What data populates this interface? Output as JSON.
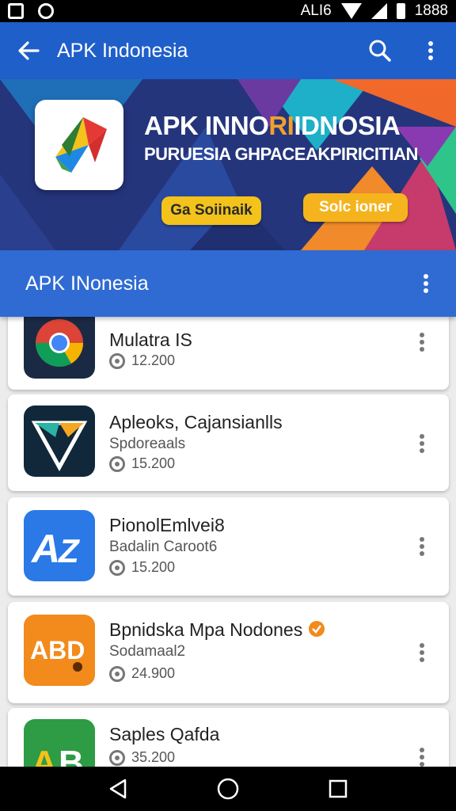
{
  "status_bar": {
    "carrier": "ΑLI6",
    "time": "1888",
    "icons": [
      "image-icon",
      "app-icon",
      "wifi-icon",
      "signal-icon",
      "battery-icon"
    ]
  },
  "app_bar": {
    "title": "APK Indonesia",
    "back_icon": "arrow-left-icon",
    "search_icon": "search-icon",
    "menu_icon": "more-vert-icon"
  },
  "banner": {
    "headline_part1": "APK INNO",
    "headline_part2": "RI",
    "headline_part3": "IDNOSIA",
    "subline": "PURUESIA GHPACEAKPIRICITIAN",
    "button1_label": "Ga Soiinaik",
    "button2_label": "Solc ioner",
    "colors": {
      "accent": "#f3c21b",
      "bg": "#24357a"
    }
  },
  "section": {
    "title": "APK INonesia",
    "menu_icon": "more-vert-icon"
  },
  "apps": [
    {
      "name": "Mulatra IS",
      "sub": "",
      "downloads": "12.200",
      "icon": "chrome-icon"
    },
    {
      "name": "Apleoks, Cajansianlls",
      "sub": "Spdoreaals",
      "downloads": "15.200",
      "icon": "vpn-shield-icon"
    },
    {
      "name": "PionolEmlvei8",
      "sub": "Badalin Caroot6",
      "downloads": "15.200",
      "icon": "translate-icon"
    },
    {
      "name": "Bpnidska Mpa Nodones",
      "sub": "Sodamaal2",
      "downloads": "24.900",
      "icon": "abd-icon"
    },
    {
      "name": "Saples Qafda",
      "sub": "",
      "downloads": "35.200",
      "icon": "aa-icon"
    }
  ],
  "nav": {
    "back": "nav-back-icon",
    "home": "nav-home-icon",
    "recents": "nav-recents-icon"
  }
}
